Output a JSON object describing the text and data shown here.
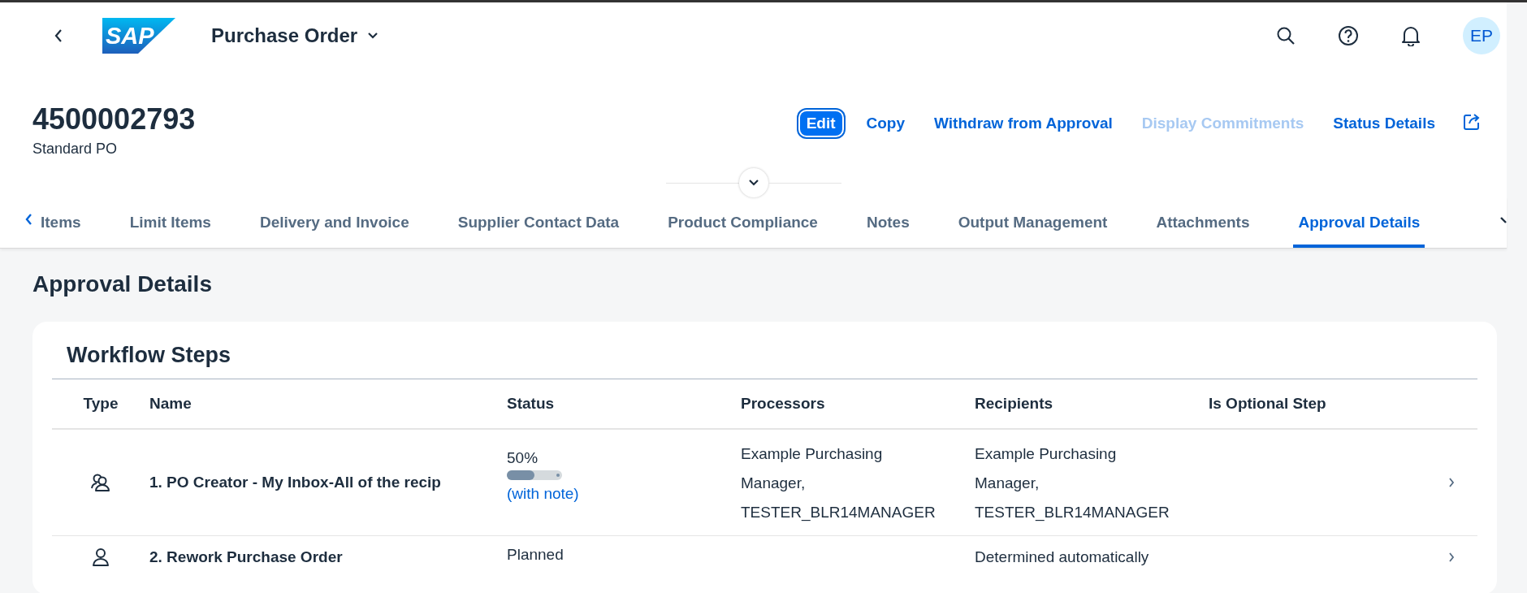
{
  "shell": {
    "logo": "SAP",
    "title": "Purchase Order",
    "avatar": "EP"
  },
  "header": {
    "title": "4500002793",
    "subtitle": "Standard PO",
    "actions": [
      {
        "label": "Edit",
        "kind": "emphasized",
        "disabled": false
      },
      {
        "label": "Copy",
        "kind": "link",
        "disabled": false
      },
      {
        "label": "Withdraw from Approval",
        "kind": "link",
        "disabled": false
      },
      {
        "label": "Display Commitments",
        "kind": "link",
        "disabled": true
      },
      {
        "label": "Status Details",
        "kind": "link",
        "disabled": false
      }
    ]
  },
  "tabs": [
    {
      "label": "Items",
      "selected": false
    },
    {
      "label": "Limit Items",
      "selected": false
    },
    {
      "label": "Delivery and Invoice",
      "selected": false
    },
    {
      "label": "Supplier Contact Data",
      "selected": false
    },
    {
      "label": "Product Compliance",
      "selected": false
    },
    {
      "label": "Notes",
      "selected": false
    },
    {
      "label": "Output Management",
      "selected": false
    },
    {
      "label": "Attachments",
      "selected": false
    },
    {
      "label": "Approval Details",
      "selected": true
    }
  ],
  "section": {
    "title": "Approval Details"
  },
  "table": {
    "title": "Workflow Steps",
    "columns": [
      "Type",
      "Name",
      "Status",
      "Processors",
      "Recipients",
      "Is Optional Step"
    ],
    "rows": [
      {
        "kind": "group",
        "name": "1. PO Creator - My Inbox-All of the recip",
        "status": {
          "kind": "progress",
          "text": "50%",
          "level": 0.5,
          "note": "(with note)"
        },
        "processors": [
          "Example Purchasing",
          "Manager,",
          "TESTER_BLR14MANAGER"
        ],
        "recipients": [
          "Example Purchasing",
          "Manager,",
          "TESTER_BLR14MANAGER"
        ]
      },
      {
        "kind": "person",
        "name": "2. Rework Purchase Order",
        "status": {
          "kind": "text",
          "text": "Planned"
        },
        "processors": [],
        "recipients": [
          "Determined automatically"
        ]
      }
    ]
  }
}
